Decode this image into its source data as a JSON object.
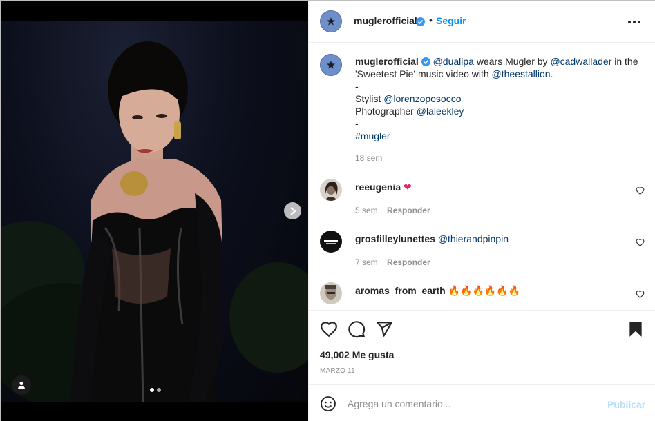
{
  "post": {
    "username": "muglerofficial",
    "follow_label": "Seguir",
    "separator": "•",
    "colors": {
      "accent": "#0095f6",
      "link": "#00376b",
      "muted": "#8e8e8e",
      "verified": "#3897f0"
    }
  },
  "media": {
    "slide_count": 2,
    "active_slide": 1
  },
  "caption": {
    "username": "muglerofficial",
    "mention_1": "@dualipa",
    "text_1": " wears Mugler by ",
    "mention_2": "@cadwallader",
    "text_2": " in the 'Sweetest Pie' music video with ",
    "mention_3": "@theestallion",
    "text_3": ".",
    "dash_1": "-",
    "stylist_label": "Stylist ",
    "stylist_mention": "@lorenzoposocco",
    "photographer_label": "Photographer ",
    "photographer_mention": "@laleekley",
    "dash_2": "-",
    "hashtag": "#mugler",
    "time": "18 sem"
  },
  "comments": [
    {
      "username": "reeugenia",
      "text": "",
      "emoji": "❤",
      "time": "5 sem",
      "reply_label": "Responder"
    },
    {
      "username": "grosfilleylunettes",
      "text": "@thierandpinpin",
      "emoji": "",
      "time": "7 sem",
      "reply_label": "Responder"
    },
    {
      "username": "aromas_from_earth",
      "text": "",
      "emoji": "🔥🔥🔥🔥🔥🔥",
      "time": "",
      "reply_label": ""
    }
  ],
  "actions": {
    "likes": "49,002 Me gusta",
    "date": "MARZO 11"
  },
  "add_comment": {
    "placeholder": "Agrega un comentario...",
    "publish_label": "Publicar"
  }
}
